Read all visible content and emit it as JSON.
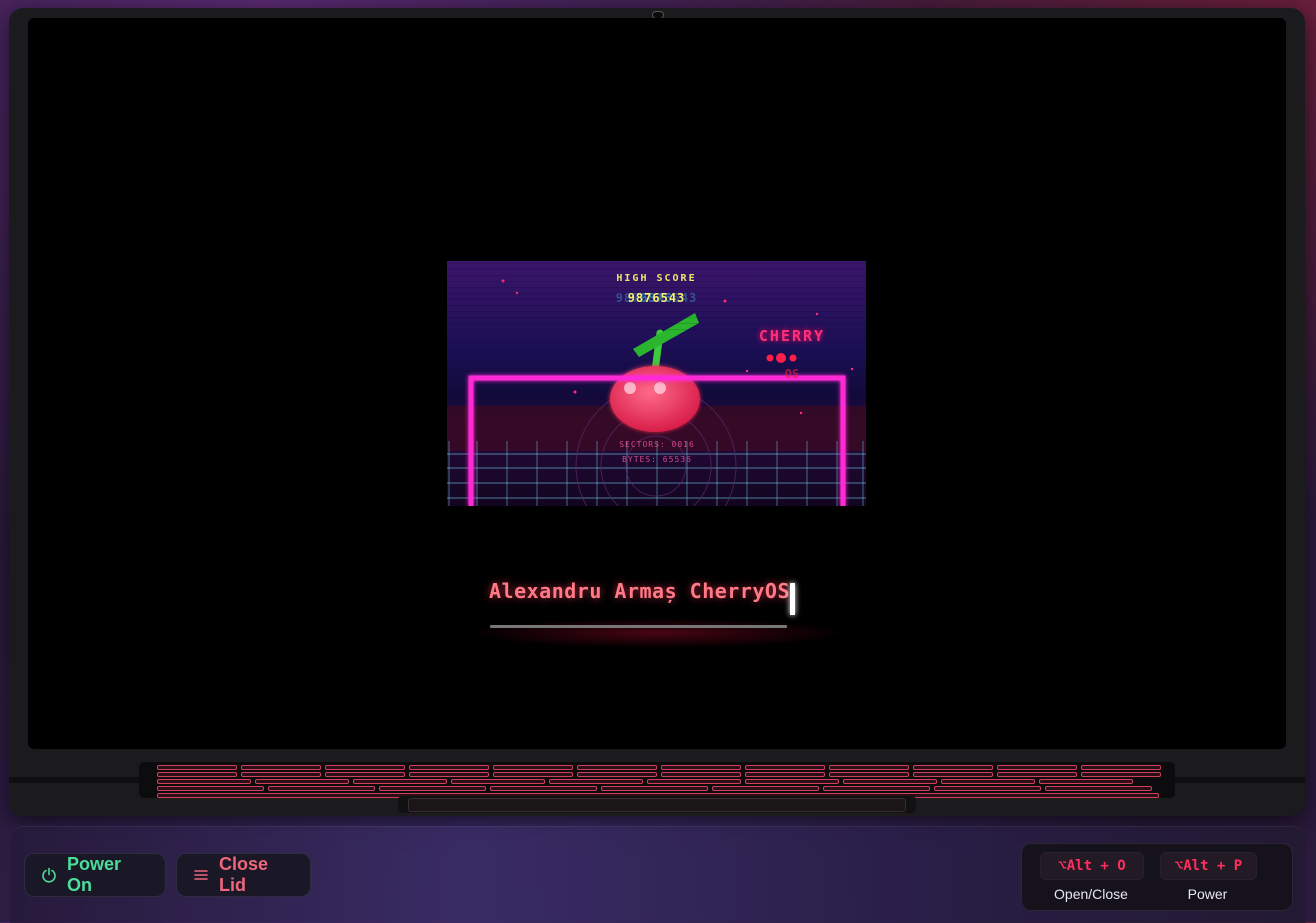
{
  "splash": {
    "high_score_label": "HIGH SCORE",
    "high_score_value": "9876543",
    "brand": "CHERRY",
    "brand_sub": "OS",
    "sectors": "SECTORS: 0016",
    "bytes": "BYTES: 65536"
  },
  "boot": {
    "text": "Alexandru Armaș CherryOS"
  },
  "controls": {
    "power_label": "Power On",
    "lid_label": "Close Lid"
  },
  "shortcuts": [
    {
      "keys": "⌥Alt + O",
      "label": "Open/Close"
    },
    {
      "keys": "⌥Alt + P",
      "label": "Power"
    }
  ],
  "colors": {
    "accent_green": "#4ade9a",
    "accent_pink": "#f0667a",
    "shortcut_red": "#ff2e5e",
    "neon_magenta": "#ff2bd6"
  }
}
